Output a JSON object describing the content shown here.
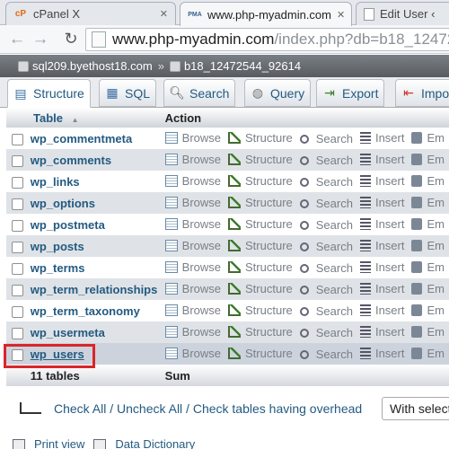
{
  "browser": {
    "tabs": [
      {
        "favicon": "cP",
        "title": "cPanel X"
      },
      {
        "favicon": "PMA",
        "title": "www.php-myadmin.com"
      },
      {
        "favicon": "",
        "title": "Edit User ‹"
      }
    ],
    "url_host": "www.php-myadmin.com",
    "url_path": "/index.php?db=b18_12472544_92614"
  },
  "pma": {
    "server": "sql209.byethost18.com",
    "breadcrumb_sep": "»",
    "database": "b18_12472544_92614",
    "menu": [
      {
        "label": "Structure",
        "icon": "structure-icon"
      },
      {
        "label": "SQL",
        "icon": "sql-icon"
      },
      {
        "label": "Search",
        "icon": "search-icon"
      },
      {
        "label": "Query",
        "icon": "query-icon"
      },
      {
        "label": "Export",
        "icon": "export-icon"
      },
      {
        "label": "Impo",
        "icon": "import-icon"
      }
    ],
    "table": {
      "col_table": "Table",
      "sort_indicator": "▲",
      "col_action": "Action",
      "actions": [
        "Browse",
        "Structure",
        "Search",
        "Insert",
        "Em"
      ],
      "rows": [
        "wp_commentmeta",
        "wp_comments",
        "wp_links",
        "wp_options",
        "wp_postmeta",
        "wp_posts",
        "wp_terms",
        "wp_term_relationships",
        "wp_term_taxonomy",
        "wp_usermeta",
        "wp_users"
      ],
      "footer_count": "11 tables",
      "footer_sum": "Sum"
    },
    "check_all_text": "Check All / Uncheck All / Check tables having overhead",
    "with_selected": "With select",
    "bottom_links": [
      "Print view",
      "Data Dictionary"
    ]
  }
}
